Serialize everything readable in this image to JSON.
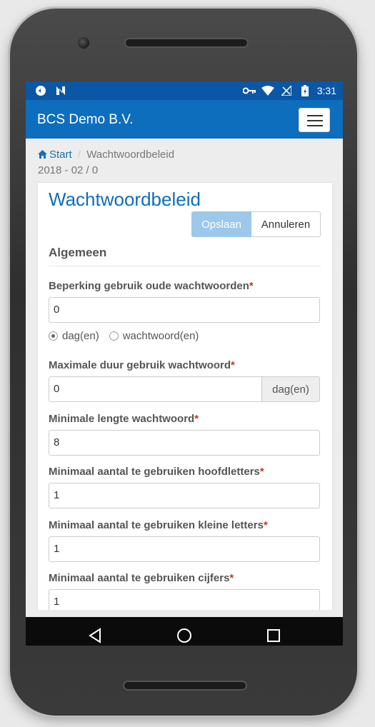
{
  "statusbar": {
    "time": "3:31",
    "left_icons": [
      "data-saver-icon",
      "n-notification-icon"
    ],
    "right_icons": [
      "vpn-key-icon",
      "wifi-icon",
      "no-signal-icon",
      "battery-charging-icon"
    ]
  },
  "appbar": {
    "title": "BCS Demo B.V.",
    "menu_icon": "hamburger-menu-icon"
  },
  "breadcrumb": {
    "home_label": "Start",
    "separator": "/",
    "current": "Wachtwoordbeleid"
  },
  "subtitle": "2018 - 02 / 0",
  "form": {
    "title": "Wachtwoordbeleid",
    "save_label": "Opslaan",
    "cancel_label": "Annuleren",
    "section_title": "Algemeen",
    "required_marker": "*",
    "fields": [
      {
        "label": "Beperking gebruik oude wachtwoorden",
        "value": "0"
      },
      {
        "label": "Maximale duur gebruik wachtwoord",
        "value": "0",
        "addon": "dag(en)"
      },
      {
        "label": "Minimale lengte wachtwoord",
        "value": "8"
      },
      {
        "label": "Minimaal aantal te gebruiken hoofdletters",
        "value": "1"
      },
      {
        "label": "Minimaal aantal te gebruiken kleine letters",
        "value": "1"
      },
      {
        "label": "Minimaal aantal te gebruiken cijfers",
        "value": "1"
      }
    ],
    "radio_options": [
      {
        "label": "dag(en)",
        "checked": true
      },
      {
        "label": "wachtwoord(en)",
        "checked": false
      }
    ]
  },
  "navbar": {
    "icons": [
      "back-triangle-icon",
      "home-circle-icon",
      "recents-square-icon"
    ]
  },
  "colors": {
    "statusbar": "#0a57a6",
    "appbar": "#0d6ebd",
    "title": "#0d6ebd",
    "save_button": "#9cc8eb",
    "required": "#c0392b"
  }
}
